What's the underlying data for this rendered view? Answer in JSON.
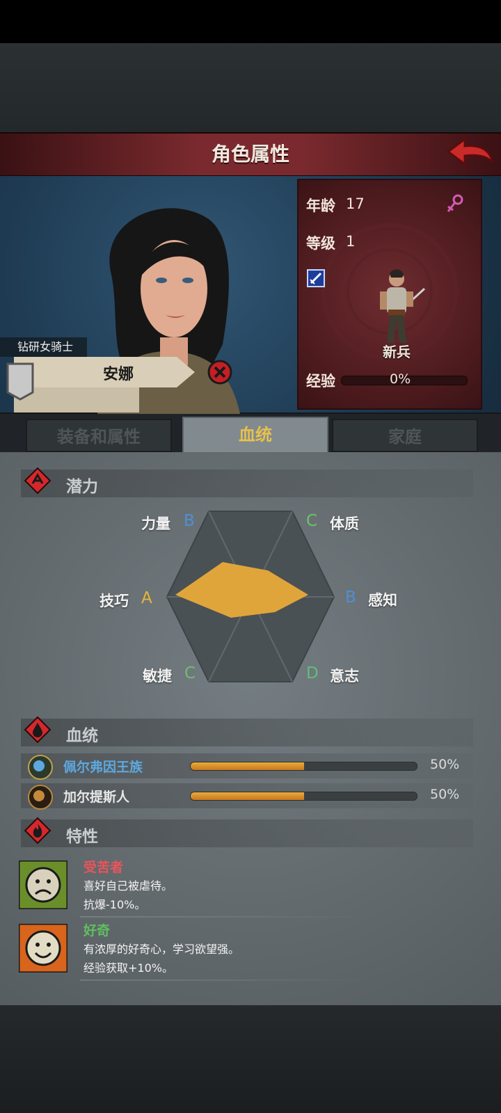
{
  "header": {
    "title": "角色属性"
  },
  "info": {
    "age_label": "年龄",
    "age_value": "17",
    "level_label": "等级",
    "level_value": "1",
    "rank": "新兵",
    "exp_label": "经验",
    "exp_value": "0%",
    "exp_progress": 0
  },
  "character": {
    "class": "钻研女骑士",
    "name": "安娜"
  },
  "tabs": [
    {
      "label": "装备和属性",
      "active": false
    },
    {
      "label": "血统",
      "active": true
    },
    {
      "label": "家庭",
      "active": false
    }
  ],
  "potential": {
    "title": "潜力",
    "stats": [
      {
        "name": "力量",
        "grade": "B"
      },
      {
        "name": "体质",
        "grade": "C"
      },
      {
        "name": "感知",
        "grade": "B"
      },
      {
        "name": "意志",
        "grade": "D"
      },
      {
        "name": "敏捷",
        "grade": "C"
      },
      {
        "name": "技巧",
        "grade": "A"
      }
    ]
  },
  "bloodline": {
    "title": "血统",
    "rows": [
      {
        "name": "佩尔弗因王族",
        "percent": "50%",
        "fraction": 0.5,
        "color": "#5ea8df"
      },
      {
        "name": "加尔提斯人",
        "percent": "50%",
        "fraction": 0.5,
        "color": "#e8e8e8"
      }
    ]
  },
  "traits": {
    "title": "特性",
    "items": [
      {
        "name": "受苦者",
        "desc": "喜好自己被虐待。",
        "effect": "抗爆-10%。",
        "color": "#e8555a"
      },
      {
        "name": "好奇",
        "desc": "有浓厚的好奇心，学习欲望强。",
        "effect": "经验获取+10%。",
        "color": "#5ec05e"
      }
    ]
  },
  "colors": {
    "accent_gold": "#e8b43b",
    "header_red": "#7a2a2e"
  }
}
